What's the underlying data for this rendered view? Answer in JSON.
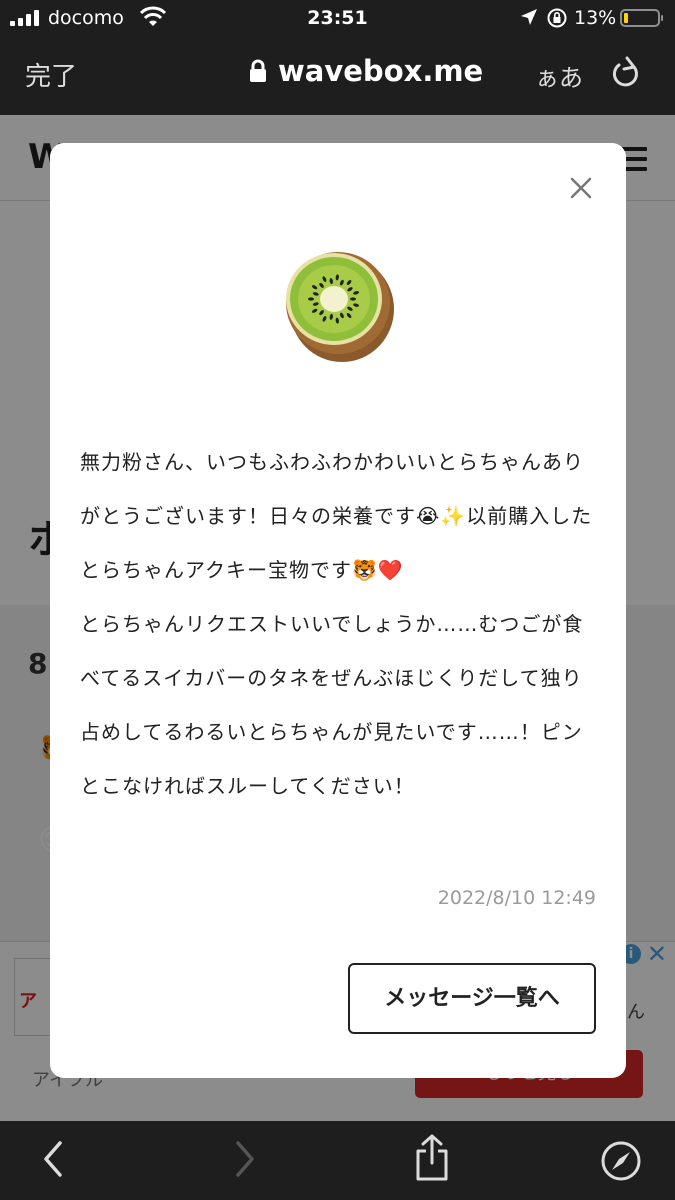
{
  "status_bar": {
    "carrier": "docomo",
    "time": "23:51",
    "battery_percent": "13%",
    "battery_level": 0.13,
    "battery_color": "#ffd60a"
  },
  "browser": {
    "done_label": "完了",
    "url": "wavebox.me",
    "text_size_label": "ぁあ",
    "icons": [
      "lock-icon",
      "reload-icon",
      "back-icon",
      "forward-icon",
      "share-icon",
      "compass-icon"
    ]
  },
  "background_page": {
    "logo_partial": "W",
    "heading_partial": "ホ",
    "count_partial": "8",
    "ad": {
      "logo_partial": "ア",
      "text_partial": "ん",
      "advertiser": "アイフル",
      "cta_label": "もっと見る"
    }
  },
  "modal": {
    "emoji": "kiwi",
    "message": "無力粉さん、いつもふわふわかわいいとらちゃんありがとうございます！日々の栄養です😭✨以前購入したとらちゃんアクキー宝物です🐯❤️\nとらちゃんリクエストいいでしょうか……むつごが食べてるスイカバーのタネをぜんぶほじくりだして独り占めしてるわるいとらちゃんが見たいです……！ピンとこなければスルーしてください！",
    "date": "2022/8/10 12:49",
    "button_label": "メッセージ一覧へ"
  }
}
